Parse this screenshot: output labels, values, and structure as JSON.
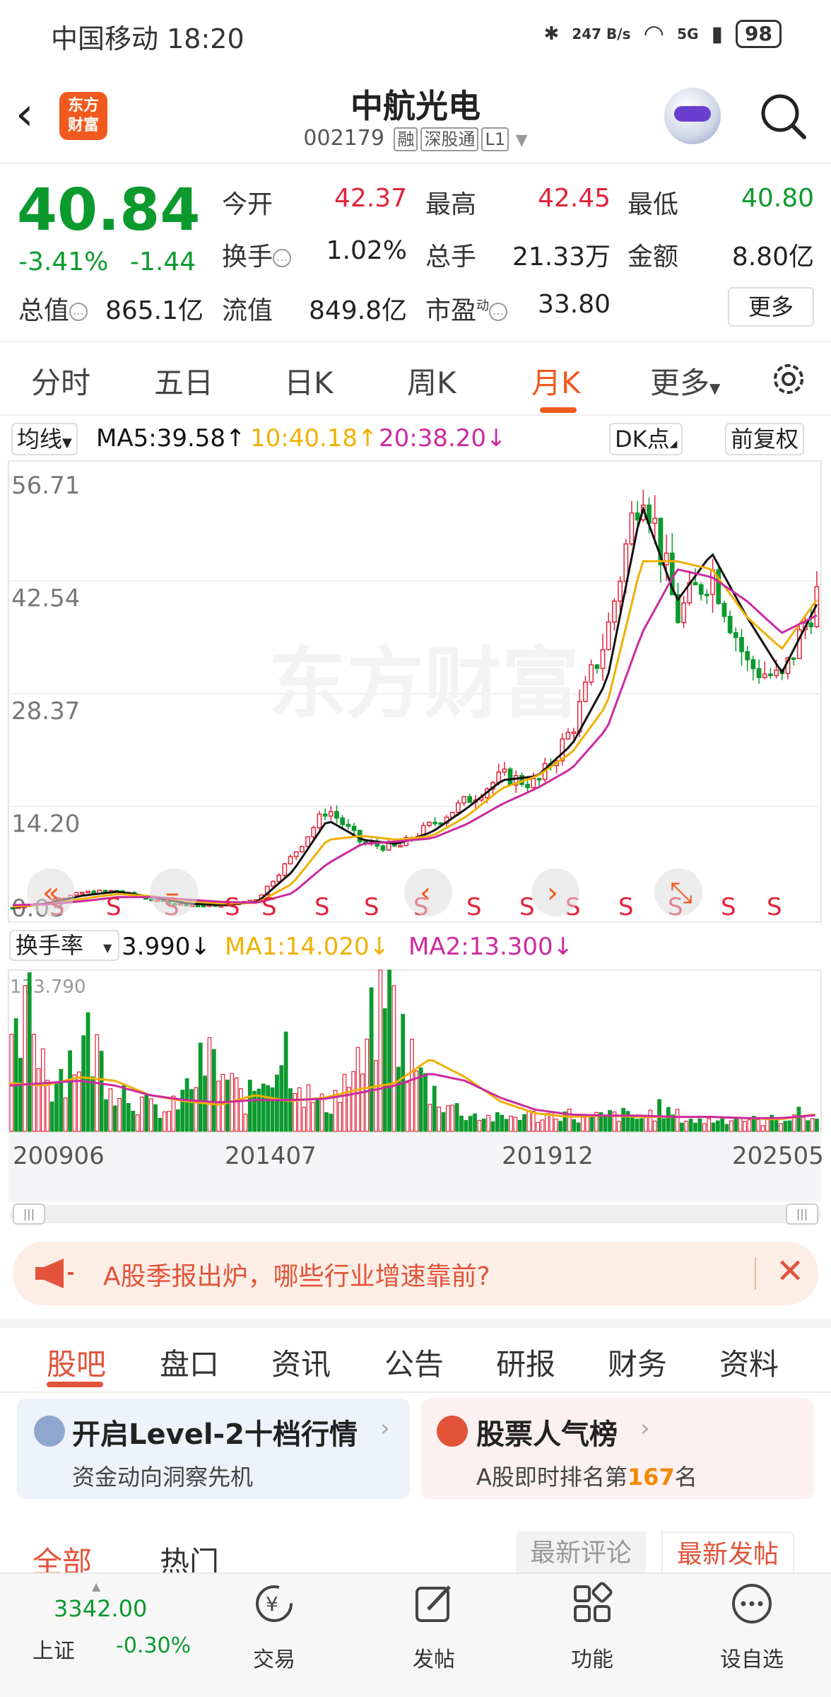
{
  "status": {
    "carrier": "中国移动",
    "time": "18:20",
    "net_speed": "247 B/s",
    "signal": "5G",
    "battery": "98"
  },
  "header": {
    "stock_name": "中航光电",
    "code": "002179",
    "tags": [
      "融",
      "深股通",
      "L1"
    ],
    "logo_text": "东方财富"
  },
  "quote": {
    "price": "40.84",
    "change_pct": "-3.41%",
    "change": "-1.44",
    "open_label": "今开",
    "open": "42.37",
    "high_label": "最高",
    "high": "42.45",
    "low_label": "最低",
    "low": "40.80",
    "turnover_label": "换手",
    "turnover": "1.02%",
    "volume_label": "总手",
    "volume": "21.33万",
    "amount_label": "金额",
    "amount": "8.80亿",
    "mktcap_label": "总值",
    "mktcap": "865.1亿",
    "float_label": "流值",
    "float_cap": "849.8亿",
    "pe_label": "市盈",
    "pe_sup": "动",
    "pe": "33.80",
    "more": "更多"
  },
  "period_tabs": [
    "分时",
    "五日",
    "日K",
    "周K",
    "月K",
    "更多"
  ],
  "active_period": "月K",
  "ma_row": {
    "selector": "均线",
    "ma5": "MA5:39.58↑",
    "ma10": "10:40.18↑",
    "ma20": "20:38.20↓",
    "dk": "DK点",
    "adjust": "前复权"
  },
  "vol_row": {
    "selector": "换手率",
    "value": "3.990↓",
    "ma1": "MA1:14.020↓",
    "ma2": "MA2:13.300↓"
  },
  "watermark": "东方财富",
  "chart_data": [
    {
      "type": "candlestick",
      "title": "月K",
      "y_ticks": [
        "56.71",
        "42.54",
        "28.37",
        "14.20",
        "0.03"
      ],
      "ylim": [
        0.03,
        56.71
      ],
      "x_ticks": [
        "200906",
        "201407",
        "201912",
        "202505"
      ],
      "series": [
        {
          "name": "MA5",
          "color": "#111111",
          "values": [
            1.5,
            2.0,
            3.0,
            3.5,
            2.8,
            2.0,
            1.8,
            2.2,
            6.0,
            12.5,
            10.0,
            9.5,
            11.0,
            14.0,
            17.5,
            18.0,
            22.0,
            30.0,
            52.0,
            40.0,
            46.0,
            38.0,
            31.0,
            39.58
          ]
        },
        {
          "name": "MA10",
          "color": "#f0b000",
          "values": [
            1.6,
            1.9,
            2.6,
            3.2,
            2.9,
            2.3,
            2.0,
            2.1,
            4.5,
            10.0,
            10.5,
            10.0,
            10.5,
            13.0,
            16.5,
            18.0,
            21.0,
            27.0,
            45.0,
            45.0,
            44.0,
            38.0,
            34.0,
            40.18
          ]
        },
        {
          "name": "MA20",
          "color": "#cc2aa0",
          "values": [
            1.8,
            1.9,
            2.3,
            2.8,
            2.8,
            2.5,
            2.2,
            2.1,
            3.3,
            7.0,
            9.5,
            9.8,
            10.2,
            12.0,
            14.5,
            16.5,
            19.0,
            24.0,
            36.0,
            44.0,
            43.0,
            40.0,
            36.0,
            38.2
          ]
        }
      ],
      "price_path": [
        1.5,
        2.2,
        3.4,
        3.6,
        2.4,
        1.8,
        1.7,
        2.6,
        8.0,
        14.0,
        9.5,
        9.0,
        12.0,
        15.0,
        18.0,
        17.0,
        24.0,
        36.0,
        56.0,
        38.0,
        44.0,
        32.0,
        30.0,
        40.84
      ],
      "markers": [
        "S",
        "S",
        "S",
        "S",
        "S",
        "S",
        "S",
        "S",
        "S",
        "S",
        "S",
        "S",
        "S",
        "S",
        "S",
        "S",
        "S"
      ]
    },
    {
      "type": "bar",
      "title": "换手率",
      "y_ticks": [
        "133.790"
      ],
      "ylim": [
        0,
        133.79
      ],
      "values": [
        55,
        100,
        40,
        60,
        75,
        45,
        30,
        20,
        15,
        35,
        60,
        40,
        25,
        50,
        70,
        30,
        20,
        40,
        55,
        133.79,
        70,
        40,
        25,
        15,
        12,
        10,
        14,
        12,
        16,
        10,
        12,
        14,
        10,
        18,
        12,
        8,
        10,
        12,
        8,
        10,
        14,
        10
      ],
      "ma1": [
        40,
        38,
        45,
        42,
        30,
        25,
        22,
        30,
        25,
        28,
        35,
        40,
        60,
        45,
        25,
        15,
        12,
        13,
        12,
        12,
        12,
        11,
        10,
        14.02
      ],
      "ma2": [
        38,
        40,
        42,
        38,
        30,
        26,
        24,
        26,
        26,
        27,
        32,
        38,
        48,
        42,
        28,
        18,
        14,
        13,
        13,
        12,
        12,
        11,
        11,
        13.3
      ]
    }
  ],
  "nav_buttons": [
    "«",
    "–",
    "‹",
    "›",
    "⤡"
  ],
  "banner": {
    "text": "A股季报出炉，哪些行业增速靠前?"
  },
  "sub_tabs": [
    "股吧",
    "盘口",
    "资讯",
    "公告",
    "研报",
    "财务",
    "资料"
  ],
  "active_sub_tab": "股吧",
  "cards": [
    {
      "title": "开启Level-2十档行情",
      "subtitle": "资金动向洞察先机"
    },
    {
      "title": "股票人气榜",
      "subtitle_prefix": "A股即时排名第",
      "rank": "167",
      "subtitle_suffix": "名"
    }
  ],
  "feed": {
    "tabs": [
      "全部",
      "热门"
    ],
    "seg": [
      "最新评论",
      "最新发帖"
    ]
  },
  "bottom": {
    "index_value": "3342.00",
    "index_name": "上证",
    "index_pct": "-0.30%",
    "items": [
      "交易",
      "发帖",
      "功能",
      "设自选"
    ]
  },
  "colors": {
    "up": "#e2233a",
    "down": "#0c9a2e",
    "accent": "#f05a1e"
  }
}
